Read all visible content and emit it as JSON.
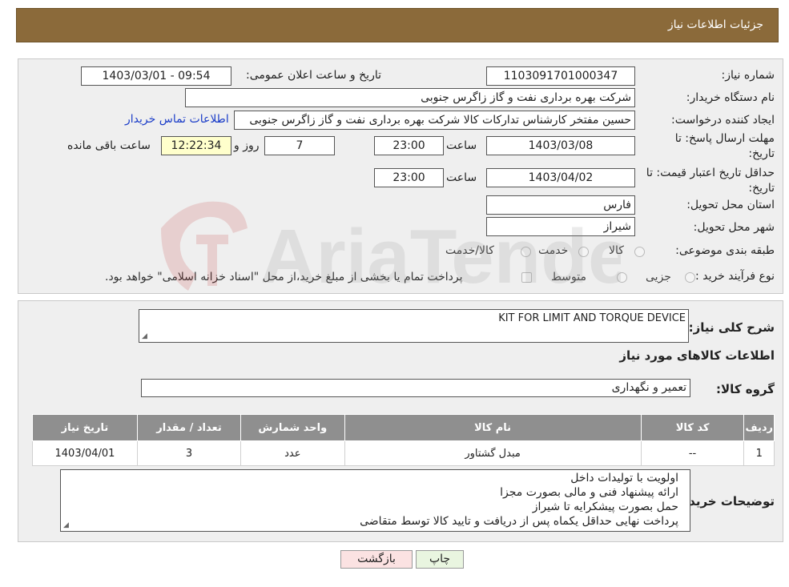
{
  "header": {
    "title": "جزئیات اطلاعات نیاز"
  },
  "form": {
    "need_number_label": "شماره نیاز:",
    "need_number": "1103091701000347",
    "announce_label": "تاریخ و ساعت اعلان عمومی:",
    "announce_value": "1403/03/01 - 09:54",
    "buyer_org_label": "نام دستگاه خریدار:",
    "buyer_org": "شرکت بهره برداری نفت و گاز زاگرس جنوبی",
    "creator_label": "ایجاد کننده درخواست:",
    "creator": "حسین مفتخر کارشناس تدارکات کالا شرکت بهره برداری نفت و گاز زاگرس جنوبی",
    "contact_link": "اطلاعات تماس خریدار",
    "deadline_label": "مهلت ارسال پاسخ: تا تاریخ:",
    "deadline_date": "1403/03/08",
    "time_label": "ساعت",
    "deadline_time": "23:00",
    "days": "7",
    "days_label": "روز و",
    "remaining_time": "12:22:34",
    "remaining_label": "ساعت باقی مانده",
    "validity_label": "حداقل تاریخ اعتبار قیمت: تا تاریخ:",
    "validity_date": "1403/04/02",
    "validity_time": "23:00",
    "province_label": "استان محل تحویل:",
    "province": "فارس",
    "city_label": "شهر محل تحویل:",
    "city": "شیراز",
    "category_label": "طبقه بندی موضوعی:",
    "category_options": [
      "کالا",
      "خدمت",
      "کالا/خدمت"
    ],
    "purchase_type_label": "نوع فرآیند خرید :",
    "purchase_options": [
      "جزیی",
      "متوسط"
    ],
    "purchase_note": "پرداخت تمام یا بخشی از مبلغ خرید،از محل \"اسناد خزانه اسلامی\" خواهد بود."
  },
  "details": {
    "general_desc_label": "شرح کلی نیاز:",
    "general_desc": "KIT FOR LIMIT AND TORQUE DEVICE",
    "goods_info_title": "اطلاعات کالاهای مورد نیاز",
    "goods_group_label": "گروه کالا:",
    "goods_group": "تعمیر و نگهداری",
    "table_headers": [
      "ردیف",
      "کد کالا",
      "نام کالا",
      "واحد شمارش",
      "تعداد / مقدار",
      "تاریخ نیاز"
    ],
    "table_rows": [
      [
        "1",
        "--",
        "مبدل گشتاور",
        "عدد",
        "3",
        "1403/04/01"
      ]
    ],
    "buyer_notes_label": "توضیحات خریدار:",
    "buyer_notes": [
      "اولویت با تولیدات داخل",
      "ارائه پیشنهاد فنی و مالی بصورت مجزا",
      "حمل بصورت پیشکرایه تا شیراز",
      "پرداخت نهایی حداقل یکماه پس از دریافت و تایید کالا توسط متقاضی"
    ]
  },
  "buttons": {
    "print": "چاپ",
    "back": "بازگشت"
  },
  "watermark_text": "AriaTender.neT",
  "colors": {
    "header": "#8b6a3a",
    "table_header": "#8f8f8f",
    "link": "#1a3cc8"
  }
}
